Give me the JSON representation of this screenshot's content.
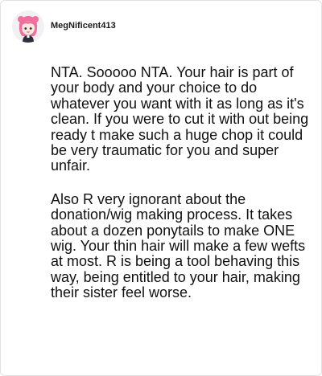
{
  "comment": {
    "author": "MegNificent413",
    "avatar_icon": "pink-haired-character-avatar",
    "paragraphs": [
      "NTA. Sooooo NTA. Your hair is part of your body and your choice to do whatever you want with it as long as it's clean. If you were to cut it with out being ready t make such a huge chop it could be very traumatic for you and super unfair.",
      "Also R very ignorant about the donation/wig making process. It takes about a dozen ponytails to make ONE wig. Your thin hair will make a few wefts at most. R is being a tool behaving this way, being entitled to your hair, making their sister feel worse."
    ]
  }
}
